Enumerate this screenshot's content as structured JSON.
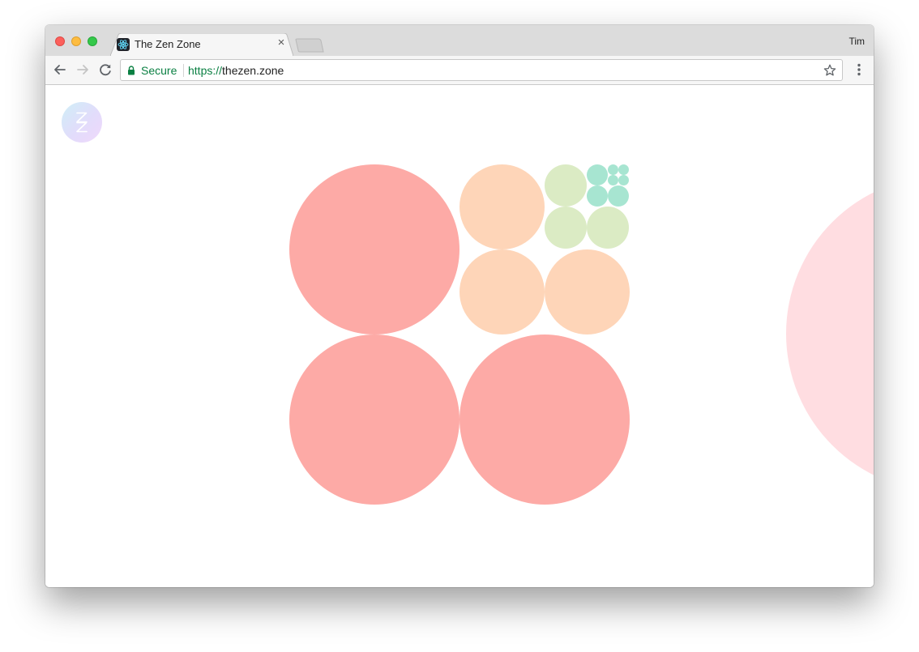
{
  "browser": {
    "tab_title": "The Zen Zone",
    "tab_close": "×",
    "profile_name": "Tim",
    "secure_label": "Secure",
    "url_scheme": "https://",
    "url_host": "thezen.zone"
  },
  "colors": {
    "coral": "#fdaaa6",
    "peach": "#fed5b8",
    "lime": "#dbebc4",
    "mint": "#a7e5d1",
    "pink": "#ffdde1",
    "secure_green": "#0b8043"
  },
  "icons": {
    "favicon": "react-atom-icon",
    "logo": "zen-z-logo-icon",
    "back": "arrow-left-icon",
    "forward": "arrow-right-icon",
    "reload": "reload-icon",
    "lock": "lock-icon",
    "bookmark": "star-icon",
    "menu": "vertical-dots-icon"
  }
}
